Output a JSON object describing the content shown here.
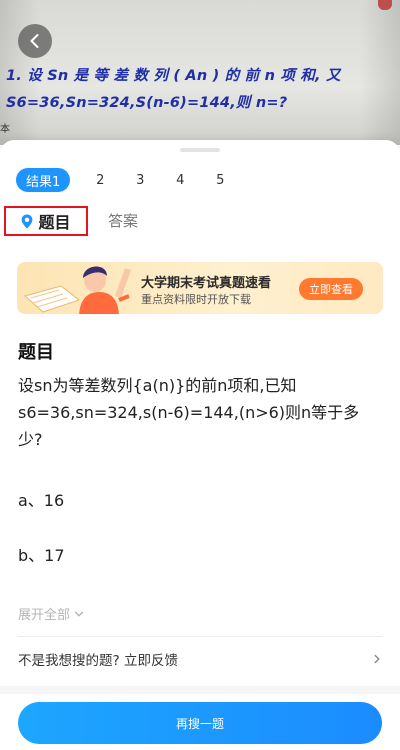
{
  "photo": {
    "line1": "1. 设 Sn 是 等 差 数 列 ( An ) 的 前 n 项 和, 又",
    "line2": "S6=36,Sn=324,S(n-6)=144,则 n=?",
    "fragment": "本"
  },
  "result_tabs": [
    "结果1",
    "2",
    "3",
    "4",
    "5"
  ],
  "section_tabs": {
    "question": "题目",
    "answer": "答案"
  },
  "banner": {
    "title": "大学期末考试真题速看",
    "subtitle": "重点资料限时开放下载",
    "cta": "立即查看"
  },
  "question": {
    "heading": "题目",
    "body": "设sn为等差数列{a(n)}的前n项和,已知s6=36,sn=324,s(n-6)=144,(n>6)则n等于多少?",
    "option_a": "a、16",
    "option_b": "b、17"
  },
  "expand_label": "展开全部",
  "feedback_label": "不是我想搜的题? 立即反馈",
  "search_again_label": "再搜一题",
  "colors": {
    "accent": "#1e94ff",
    "highlight_border": "#e4131d",
    "banner_cta": "#ff7a2e",
    "photo_text": "#1f2fa8"
  }
}
